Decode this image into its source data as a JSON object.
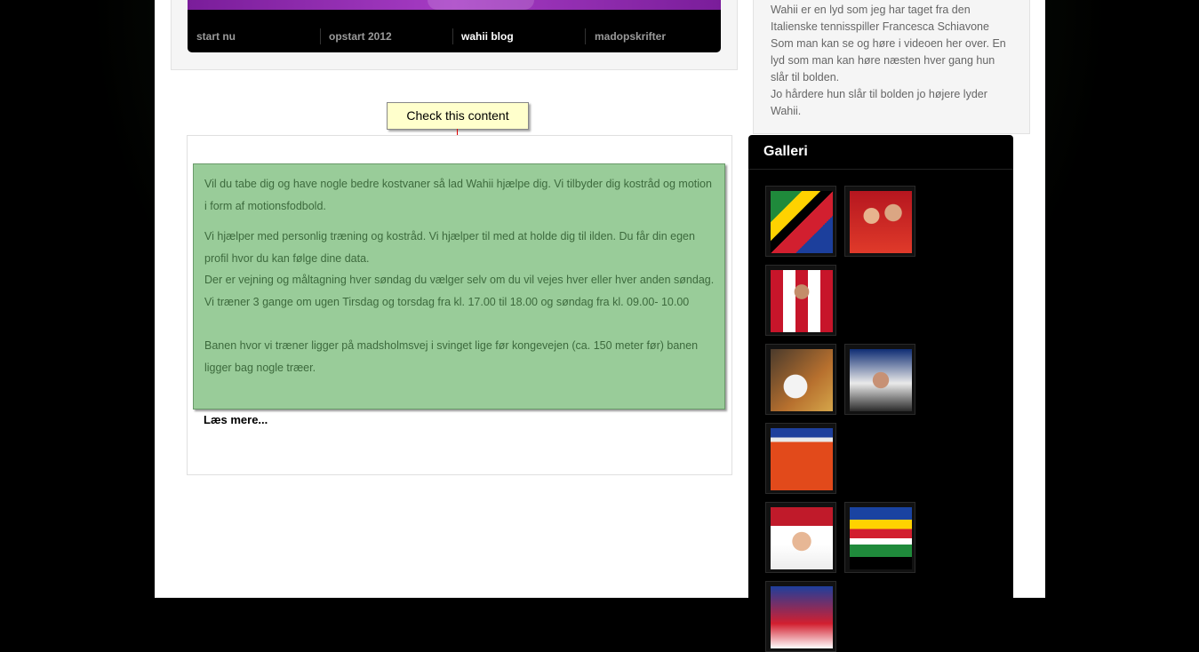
{
  "nav": {
    "items": [
      {
        "label": "start nu",
        "active": false
      },
      {
        "label": "opstart 2012",
        "active": false
      },
      {
        "label": "wahii blog",
        "active": true
      },
      {
        "label": "madopskrifter",
        "active": false
      }
    ]
  },
  "sidebar": {
    "text_lines": [
      "Wahii er en lyd som jeg har taget fra den",
      "Italienske tennisspiller Francesca Schiavone",
      "Som man kan se og høre i videoen her over. En",
      "lyd som man kan høre næsten hver gang hun",
      "slår til bolden.",
      "Jo hårdere hun slår til bolden jo højere lyder",
      "Wahii."
    ]
  },
  "tooltip": {
    "label": "Check this content"
  },
  "content": {
    "para1": "Vil du tabe dig og have nogle bedre kostvaner så lad Wahii hjælpe dig. Vi tilbyder dig kostråd og motion i form af motionsfodbold.",
    "para2_line1": "Vi hjælper med personlig træning og kostråd. Vi hjælper til med at holde dig til ilden. Du får din egen profil hvor du kan følge dine data.",
    "para2_line2": "Der er vejning og måltagning hver søndag du vælger selv om du vil vejes hver eller hver anden søndag.",
    "para2_line3": "Vi træner 3 gange om ugen Tirsdag og torsdag fra kl. 17.00 til 18.00 og søndag fra kl. 09.00- 10.00",
    "para3": "Banen hvor vi træner ligger på madsholmsvej i svinget lige før kongevejen (ca. 150 meter før) banen ligger bag nogle træer.",
    "read_more": "Læs mere..."
  },
  "gallery": {
    "title": "Galleri"
  },
  "colors": {
    "highlight_bg": "#99cc99",
    "tooltip_bg": "#ffffcc",
    "arrow": "#dd0000",
    "nav_banner": "#a63cc4"
  }
}
